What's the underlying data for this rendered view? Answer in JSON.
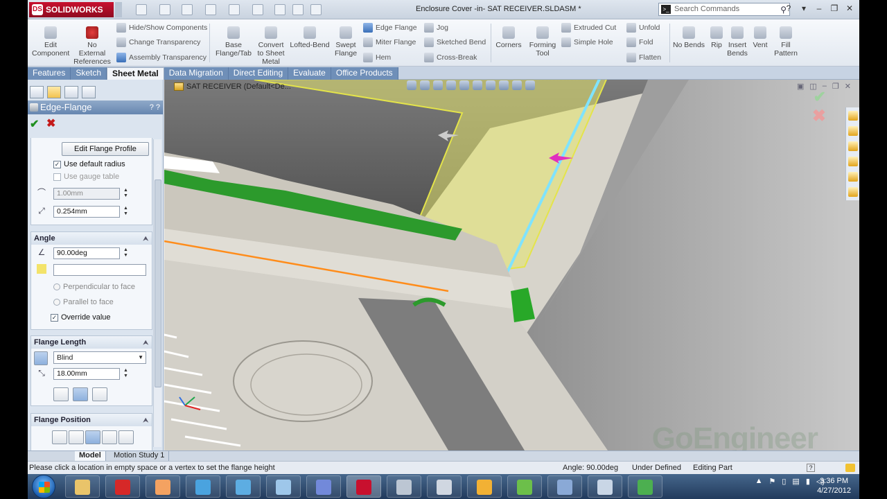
{
  "app": {
    "brand": "SOLIDWORKS",
    "brand_mark": "DS",
    "doc_title": "Enclosure Cover -in- SAT RECEIVER.SLDASM *",
    "search_placeholder": "Search Commands",
    "search_prefix_icon": "terminal-icon"
  },
  "window_controls": [
    "?",
    "▾",
    "–",
    "❐",
    "✕"
  ],
  "ribbon": {
    "large_left": [
      {
        "label": "Edit\nComponent",
        "icon": "edit-component-icon"
      },
      {
        "label": "No\nExternal\nReferences",
        "icon": "no-external-references-icon"
      }
    ],
    "small_col1": [
      {
        "label": "Hide/Show Components",
        "icon": "hide-show-icon"
      },
      {
        "label": "Change Transparency",
        "icon": "transparency-icon"
      },
      {
        "label": "Assembly Transparency",
        "icon": "assembly-transparency-icon"
      }
    ],
    "large_mid": [
      {
        "label": "Base\nFlange/Tab",
        "icon": "base-flange-icon"
      },
      {
        "label": "Convert\nto Sheet\nMetal",
        "icon": "convert-sheet-metal-icon"
      },
      {
        "label": "Lofted-Bend",
        "icon": "lofted-bend-icon"
      },
      {
        "label": "Swept\nFlange",
        "icon": "swept-flange-icon"
      }
    ],
    "small_col2": [
      {
        "label": "Edge Flange",
        "icon": "edge-flange-icon"
      },
      {
        "label": "Miter Flange",
        "icon": "miter-flange-icon"
      },
      {
        "label": "Hem",
        "icon": "hem-icon"
      }
    ],
    "small_col3": [
      {
        "label": "Jog",
        "icon": "jog-icon"
      },
      {
        "label": "Sketched Bend",
        "icon": "sketched-bend-icon"
      },
      {
        "label": "Cross-Break",
        "icon": "cross-break-icon"
      }
    ],
    "large_mid2": [
      {
        "label": "Corners",
        "icon": "corners-icon"
      },
      {
        "label": "Forming\nTool",
        "icon": "forming-tool-icon"
      }
    ],
    "small_col4": [
      {
        "label": "Extruded Cut",
        "icon": "extruded-cut-icon"
      },
      {
        "label": "Simple Hole",
        "icon": "simple-hole-icon"
      }
    ],
    "small_col5": [
      {
        "label": "Unfold",
        "icon": "unfold-icon"
      },
      {
        "label": "Fold",
        "icon": "fold-icon"
      },
      {
        "label": "Flatten",
        "icon": "flatten-icon"
      }
    ],
    "large_right": [
      {
        "label": "No Bends",
        "icon": "no-bends-icon"
      },
      {
        "label": "Rip",
        "icon": "rip-icon"
      },
      {
        "label": "Insert\nBends",
        "icon": "insert-bends-icon"
      },
      {
        "label": "Vent",
        "icon": "vent-icon"
      },
      {
        "label": "Fill\nPattern",
        "icon": "fill-pattern-icon"
      }
    ]
  },
  "tabs": [
    {
      "label": "Features",
      "active": false
    },
    {
      "label": "Sketch",
      "active": false
    },
    {
      "label": "Sheet Metal",
      "active": true
    },
    {
      "label": "Data Migration",
      "active": false
    },
    {
      "label": "Direct Editing",
      "active": false
    },
    {
      "label": "Evaluate",
      "active": false
    },
    {
      "label": "Office Products",
      "active": false
    }
  ],
  "property_manager": {
    "title": "Edge-Flange",
    "help": "? ?",
    "ok_symbol": "✔",
    "cancel_symbol": "✖",
    "edit_flange_profile": "Edit Flange Profile",
    "use_default_radius": "Use default radius",
    "use_default_radius_checked": true,
    "use_gauge_table": "Use gauge table",
    "use_gauge_table_checked": false,
    "bend_radius": "1.00mm",
    "gap_distance": "0.254mm",
    "angle_group": {
      "title": "Angle",
      "angle_value": "90.00deg",
      "reference_value": "",
      "perpendicular": "Perpendicular to face",
      "parallel": "Parallel to face",
      "override_value": "Override value",
      "override_checked": true
    },
    "length_group": {
      "title": "Flange Length",
      "end_condition": "Blind",
      "length_value": "18.00mm"
    },
    "position_group": {
      "title": "Flange Position"
    }
  },
  "viewport": {
    "tree_root": "SAT RECEIVER (Default<De...",
    "watermark": "GoEngineer",
    "ok_symbol": "✔",
    "cancel_symbol": "✖"
  },
  "model_tabs": [
    {
      "label": "Model",
      "active": true
    },
    {
      "label": "Motion Study 1",
      "active": false
    }
  ],
  "status": {
    "message": "Please click a location in empty space or a vertex to set the flange height",
    "angle": "Angle: 90.00deg",
    "definition": "Under Defined",
    "mode": "Editing Part",
    "help": "?"
  },
  "taskbar": {
    "time": "3:36 PM",
    "date": "4/27/2012",
    "apps": [
      {
        "name": "file-explorer-icon",
        "color": "#e9c46a"
      },
      {
        "name": "stop-app-icon",
        "color": "#d62828"
      },
      {
        "name": "outlook-icon",
        "color": "#f4a261"
      },
      {
        "name": "internet-explorer-icon",
        "color": "#4aa3df"
      },
      {
        "name": "refresh-app-icon",
        "color": "#5dade2"
      },
      {
        "name": "settings-app-icon",
        "color": "#9ec7ea"
      },
      {
        "name": "network-app-icon",
        "color": "#7289da"
      },
      {
        "name": "solidworks-app-icon",
        "color": "#c8102e"
      },
      {
        "name": "tool-app-icon",
        "color": "#bcc6d3"
      },
      {
        "name": "calculator-icon",
        "color": "#d0d7e1"
      },
      {
        "name": "charts-app-icon",
        "color": "#f2b134"
      },
      {
        "name": "messenger-icon",
        "color": "#6cbf4a"
      },
      {
        "name": "sync-app-icon",
        "color": "#8aa9d6"
      },
      {
        "name": "document-app-icon",
        "color": "#c9d6e6"
      },
      {
        "name": "globe-app-icon",
        "color": "#4caf50"
      }
    ]
  }
}
